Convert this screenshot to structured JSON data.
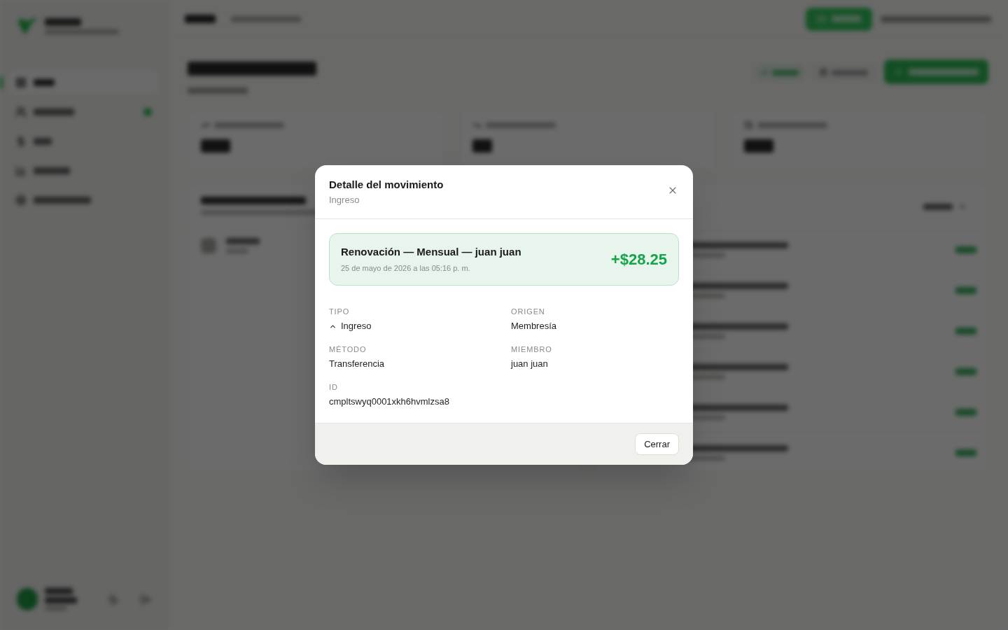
{
  "sidebar": {
    "nav": [
      {
        "selected": true,
        "alert": false
      },
      {
        "selected": false,
        "alert": true
      },
      {
        "selected": false,
        "alert": false
      },
      {
        "selected": false,
        "alert": false
      },
      {
        "selected": false,
        "alert": false
      }
    ]
  },
  "dialog": {
    "title": "Detalle del movimiento",
    "subtitle": "Ingreso",
    "summary": {
      "kind": "income",
      "title": "Renovación — Mensual — juan juan",
      "date": "25 de mayo de 2026 a las 05:16 p. m.",
      "amount": "+$28.25"
    },
    "fields": [
      {
        "kind": "direction",
        "label": "TIPO",
        "value": "Ingreso"
      },
      {
        "kind": "text",
        "label": "ORIGEN",
        "value": "Membresía"
      },
      {
        "kind": "text",
        "label": "MÉTODO",
        "value": "Transferencia"
      },
      {
        "kind": "text",
        "label": "MIEMBRO",
        "value": "juan juan"
      },
      {
        "kind": "text",
        "label": "ID",
        "value": "cmpltswyq0001xkh6hvmlzsa8"
      }
    ],
    "close_button": "Cerrar"
  }
}
